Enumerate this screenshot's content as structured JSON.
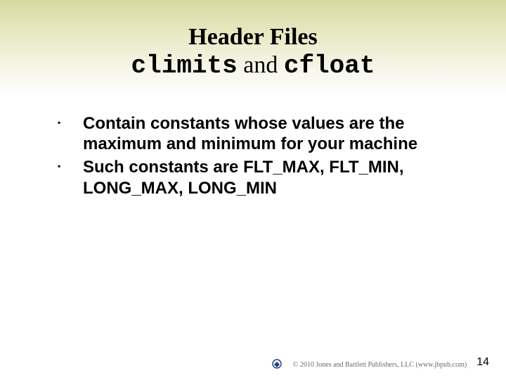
{
  "title": {
    "line1": "Header Files",
    "code1": "climits",
    "and": " and ",
    "code2": "cfloat"
  },
  "bullets": [
    "Contain constants whose values are the maximum and minimum for your machine",
    "Such constants are FLT_MAX, FLT_MIN, LONG_MAX, LONG_MIN"
  ],
  "footer": {
    "copyright": "© 2010 Jones and Bartlett Publishers, LLC (www.jbpub.com)",
    "page_number": "14"
  }
}
